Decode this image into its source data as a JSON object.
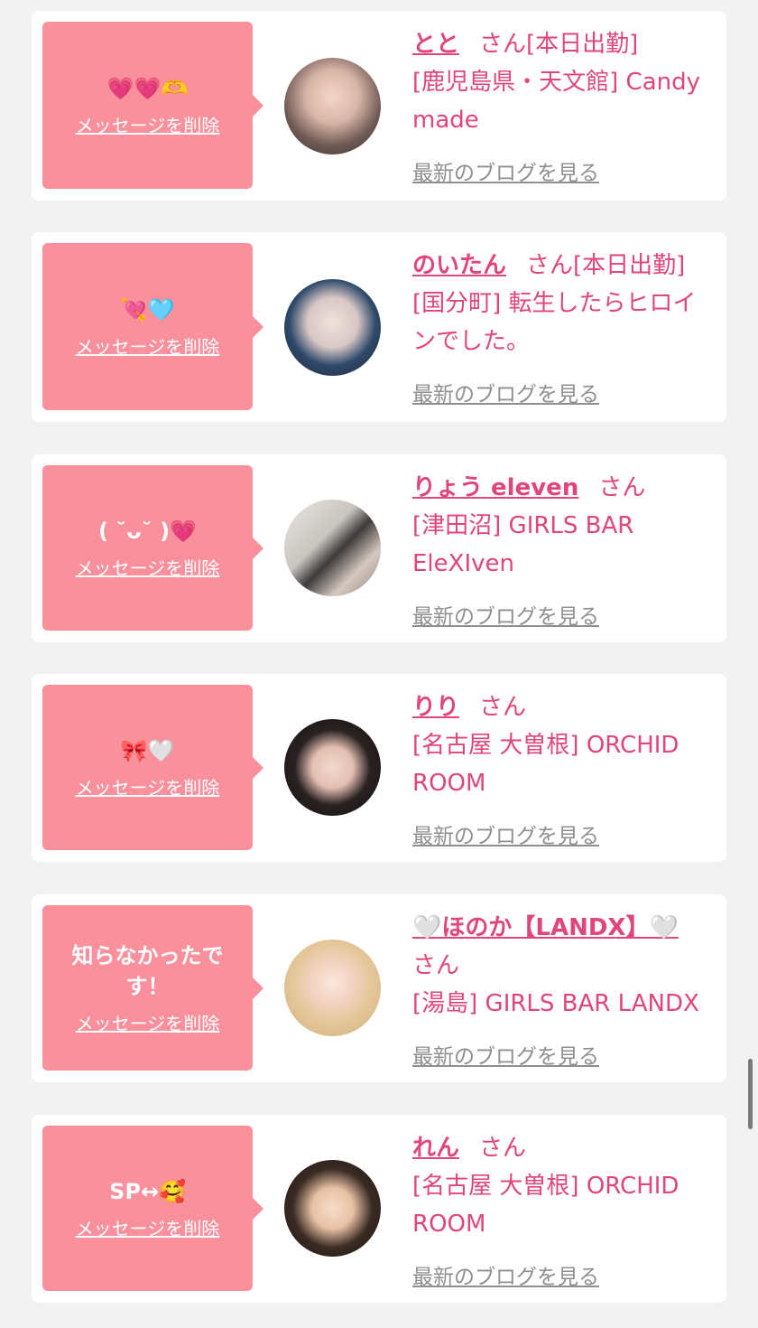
{
  "delete_label": "メッセージを削除",
  "honorific": "さん",
  "blog_label": "最新のブログを見る",
  "colors": {
    "accent": "#e0457b",
    "bubble": "#f9909c",
    "link_gray": "#8f8f8f"
  },
  "entries": [
    {
      "message": "💗💗🫶",
      "name": "とと",
      "status": "[本日出勤]",
      "shop": "[鹿児島県・天文館] Candy made"
    },
    {
      "message": "💘🩵",
      "name": "のいたん",
      "status": "[本日出勤]",
      "shop": "[国分町] 転生したらヒロインでした。"
    },
    {
      "message": "( ˘ᴗ˘ )💗",
      "name": "りょう eleven",
      "status": "",
      "shop": "[津田沼] GIRLS BAR EleXIven"
    },
    {
      "message": "🎀🤍",
      "name": "りり",
      "status": "",
      "shop": "[名古屋 大曽根] ORCHID ROOM"
    },
    {
      "message": "知らなかったです！",
      "name": "🤍ほのか【LANDX】🤍",
      "status": "",
      "shop": "[湯島] GIRLS BAR LANDX"
    },
    {
      "message": "SP↔🥰",
      "name": "れん",
      "status": "",
      "shop": "[名古屋 大曽根] ORCHID ROOM"
    }
  ]
}
